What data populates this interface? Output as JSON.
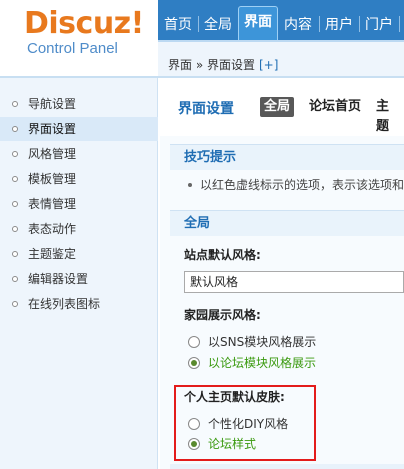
{
  "logo": {
    "word": "Discuz!",
    "subtitle": "Control Panel"
  },
  "topnav": {
    "tabs": [
      {
        "label": "首页"
      },
      {
        "label": "全局"
      },
      {
        "label": "界面"
      },
      {
        "label": "内容"
      },
      {
        "label": "用户"
      },
      {
        "label": "门户"
      }
    ],
    "active_index": 2
  },
  "breadcrumb": {
    "text": "界面 » 界面设置",
    "plus": "[+]"
  },
  "sidebar": {
    "items": [
      {
        "label": "导航设置"
      },
      {
        "label": "界面设置"
      },
      {
        "label": "风格管理"
      },
      {
        "label": "模板管理"
      },
      {
        "label": "表情管理"
      },
      {
        "label": "表态动作"
      },
      {
        "label": "主题鉴定"
      },
      {
        "label": "编辑器设置"
      },
      {
        "label": "在线列表图标"
      }
    ],
    "active_index": 1
  },
  "main": {
    "title": "界面设置",
    "subtabs": [
      {
        "label": "全局"
      },
      {
        "label": "论坛首页"
      },
      {
        "label": "主题"
      }
    ],
    "active_subtab": 0,
    "tips": {
      "heading": "技巧提示",
      "line": "以红色虚线标示的选项，表示该选项和"
    },
    "global": {
      "heading": "全局",
      "site_style_label": "站点默认风格:",
      "site_style_value": "默认风格",
      "home_style_label": "家园展示风格:",
      "home_options": [
        {
          "label": "以SNS模块风格展示",
          "checked": false
        },
        {
          "label": "以论坛模块风格展示",
          "checked": true
        }
      ],
      "skin_label": "个人主页默认皮肤:",
      "skin_options": [
        {
          "label": "个性化DIY风格",
          "checked": false
        },
        {
          "label": "论坛样式",
          "checked": true
        }
      ]
    }
  },
  "colors": {
    "accent": "#2f7ec3",
    "logo_orange": "#e8791e",
    "selected_green": "#3a9a0f",
    "highlight_red": "#e31b1b"
  }
}
